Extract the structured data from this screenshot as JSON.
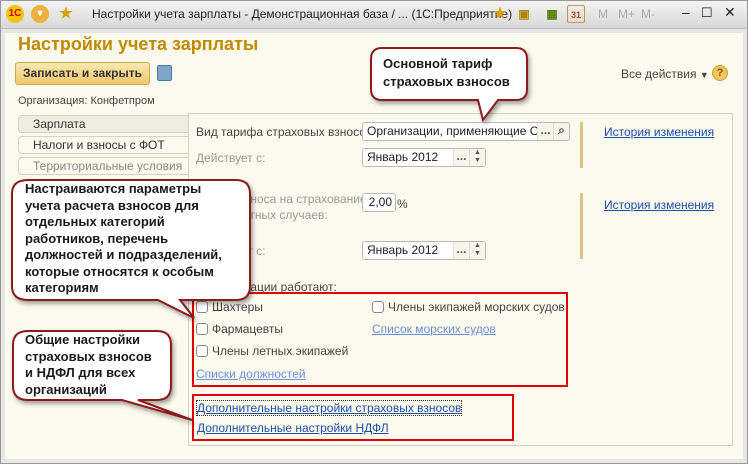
{
  "window": {
    "title": "Настройки учета зарплаты - Демонстрационная база / ...  (1С:Предприятие)",
    "logo": "1С",
    "toolbar_icons": [
      "star-icon",
      "bookmark-icon",
      "calculator-icon",
      "calendar-icon"
    ],
    "calendar_day": "31",
    "memory": [
      "M",
      "M+",
      "M-"
    ]
  },
  "form": {
    "title": "Настройки учета зарплаты",
    "save_close": "Записать и закрыть",
    "all_actions": "Все действия",
    "help": "?",
    "organization": "Организация: Конфетпром"
  },
  "tabs": [
    "Зарплата",
    "Налоги и взносы с ФОТ",
    "Территориальные условия"
  ],
  "fields": {
    "tariff_label": "Вид тарифа страховых взносов:",
    "tariff_value": "Организации, применяющие ОСН",
    "since_label": "Действует с:",
    "since_value": "Январь 2012",
    "rate_label1": "Ставка взноса на страхование",
    "rate_label2": "от несчастных случаев:",
    "rate_value": "2,00",
    "rate_unit": "%",
    "since2_value": "Январь 2012",
    "history": "История изменения",
    "dots": "..."
  },
  "employees": {
    "heading": "В организации работают:",
    "miners": "Шахтеры",
    "pharmacists": "Фармацевты",
    "flight_crews": "Члены летных экипажей",
    "sea_crews": "Члены экипажей морских судов",
    "ship_list": "Список морских судов",
    "positions_list": "Списки должностей"
  },
  "extra": {
    "insurance": "Дополнительные настройки страховых взносов",
    "ndfl": "Дополнительные настройки НДФЛ"
  },
  "callouts": {
    "c1": [
      "Основной тариф",
      "страховых взносов"
    ],
    "c2": [
      "Настраиваются параметры",
      "учета расчета взносов для",
      "отдельных категорий",
      "работников, перечень",
      "должностей и подразделений,",
      "которые относятся к особым",
      "категориям"
    ],
    "c3": [
      "Общие настройки",
      "страховых взносов",
      "и НДФЛ для всех",
      "организаций"
    ]
  },
  "colors": {
    "title": "#c08a00",
    "callout_border": "#8b1a1a",
    "highlight": "#e00000",
    "link": "#1e4ea8"
  }
}
